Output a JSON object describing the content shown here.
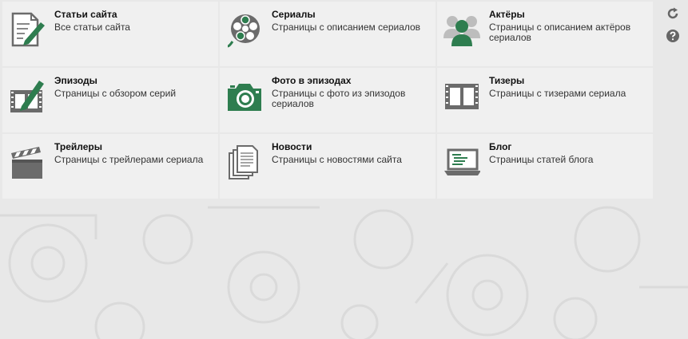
{
  "tiles": [
    {
      "title": "Статьи сайта",
      "desc": "Все статьи сайта",
      "icon": "article-edit-icon"
    },
    {
      "title": "Сериалы",
      "desc": "Страницы с описанием сериалов",
      "icon": "film-reel-icon"
    },
    {
      "title": "Актёры",
      "desc": "Страницы с описанием актёров сериалов",
      "icon": "users-icon"
    },
    {
      "title": "Эпизоды",
      "desc": "Страницы с обзором серий",
      "icon": "filmstrip-edit-icon"
    },
    {
      "title": "Фото в эпизодах",
      "desc": "Страницы с фото из эпизодов сериалов",
      "icon": "camera-icon"
    },
    {
      "title": "Тизеры",
      "desc": "Страницы с тизерами сериала",
      "icon": "filmstrip-icon"
    },
    {
      "title": "Трейлеры",
      "desc": "Страницы с трейлерами сериала",
      "icon": "clapperboard-icon"
    },
    {
      "title": "Новости",
      "desc": "Страницы с новостями сайта",
      "icon": "documents-icon"
    },
    {
      "title": "Блог",
      "desc": "Страницы статей блога",
      "icon": "laptop-icon"
    }
  ],
  "side_buttons": [
    {
      "icon": "refresh-icon"
    },
    {
      "icon": "help-icon"
    }
  ],
  "colors": {
    "accent_green": "#2e7d4f",
    "icon_gray": "#6b6b6b",
    "background": "#e8e8e8"
  }
}
